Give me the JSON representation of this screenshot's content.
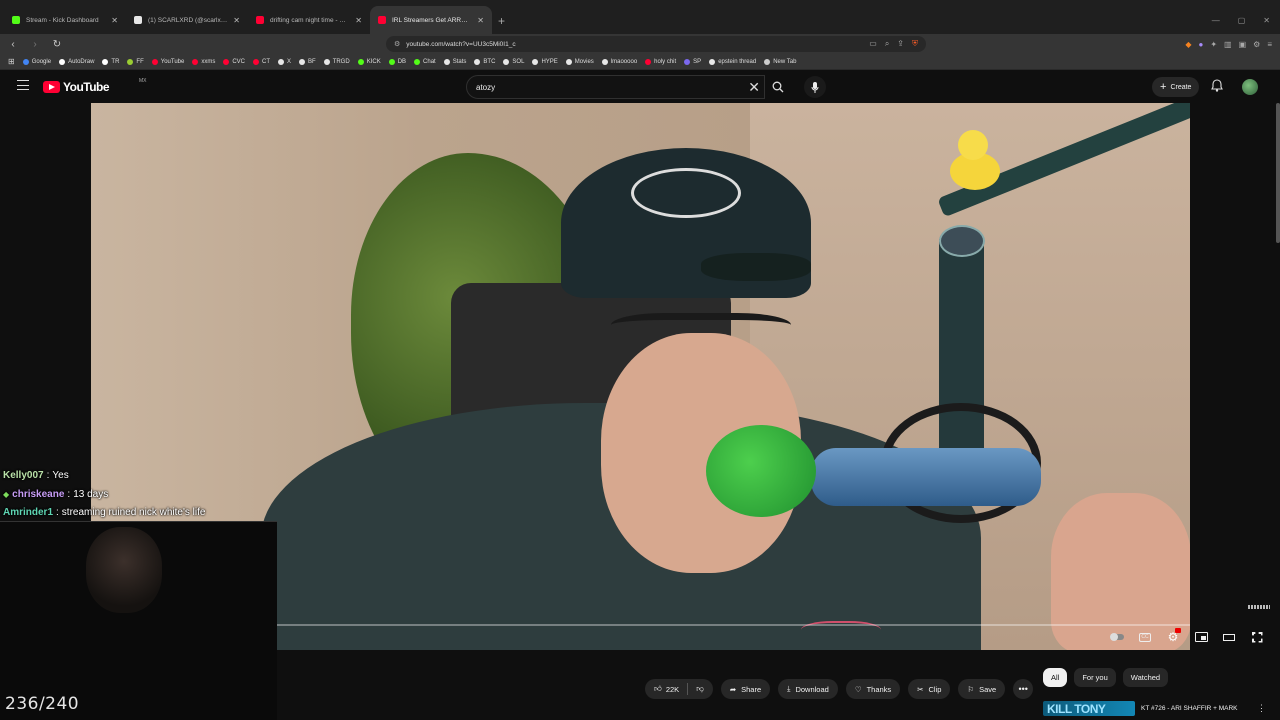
{
  "browser": {
    "tabs": [
      {
        "title": "Stream - Kick Dashboard",
        "favicon_color": "#53fc18",
        "active": false
      },
      {
        "title": "(1) SCARLXRD (@scarlxrd) / X",
        "favicon_color": "#e7e7e7",
        "active": false
      },
      {
        "title": "drifting cam night time - YouTube",
        "favicon_color": "#ff0033",
        "active": false
      },
      {
        "title": "IRL Streamers Get ARRESTED For...",
        "favicon_color": "#ff0033",
        "active": true
      }
    ],
    "new_tab_icon": "plus-icon",
    "address": "youtube.com/watch?v=UU3c5Mi0I1_c",
    "bookmarks": [
      {
        "label": "Google",
        "color": "#4285f4"
      },
      {
        "label": "AutoDraw",
        "color": "#ffffff"
      },
      {
        "label": "TR",
        "color": "#ffffff"
      },
      {
        "label": "FF",
        "color": "#9acd32"
      },
      {
        "label": "YouTube",
        "color": "#ff0033"
      },
      {
        "label": "xxms",
        "color": "#ff0033"
      },
      {
        "label": "CVC",
        "color": "#ff0033"
      },
      {
        "label": "CT",
        "color": "#ff0033"
      },
      {
        "label": "X",
        "color": "#e7e7e7"
      },
      {
        "label": "BF",
        "color": "#e7e7e7"
      },
      {
        "label": "TRGD",
        "color": "#e7e7e7"
      },
      {
        "label": "KICK",
        "color": "#53fc18"
      },
      {
        "label": "DB",
        "color": "#53fc18"
      },
      {
        "label": "Chat",
        "color": "#53fc18"
      },
      {
        "label": "Stats",
        "color": "#e7e7e7"
      },
      {
        "label": "BTC",
        "color": "#e7e7e7"
      },
      {
        "label": "SOL",
        "color": "#e7e7e7"
      },
      {
        "label": "HYPE",
        "color": "#e7e7e7"
      },
      {
        "label": "Movies",
        "color": "#e7e7e7"
      },
      {
        "label": "lmaooooo",
        "color": "#e7e7e7"
      },
      {
        "label": "holy chit",
        "color": "#ff0033"
      },
      {
        "label": "SP",
        "color": "#7b68ee"
      },
      {
        "label": "epstein thread",
        "color": "#e7e7e7"
      },
      {
        "label": "New Tab",
        "color": "#cccccc"
      }
    ]
  },
  "youtube": {
    "logo_text": "YouTube",
    "country_code": "MX",
    "search_value": "atozy",
    "create_label": "Create",
    "actions": {
      "likes": "22K",
      "share": "Share",
      "download": "Download",
      "thanks": "Thanks",
      "clip": "Clip",
      "save": "Save"
    },
    "chips": [
      "All",
      "For you",
      "Watched"
    ],
    "active_chip": "All",
    "recommended": {
      "thumb_text": "KILL TONY",
      "title": "KT #726 - ARI SHAFFIR + MARK"
    }
  },
  "overlay": {
    "chat": [
      {
        "user": "Kelly007",
        "sep": ":",
        "message": "Yes",
        "color": "#b9e1a8",
        "badge": false
      },
      {
        "user": "chriskeane",
        "sep": ":",
        "message": "13 days",
        "color": "#c79cf5",
        "badge": true
      },
      {
        "user": "Amrinder1",
        "sep": ":",
        "message": "streaming ruined nick white's life",
        "color": "#5fd6b4",
        "badge": false
      }
    ],
    "counter": "236/240"
  }
}
